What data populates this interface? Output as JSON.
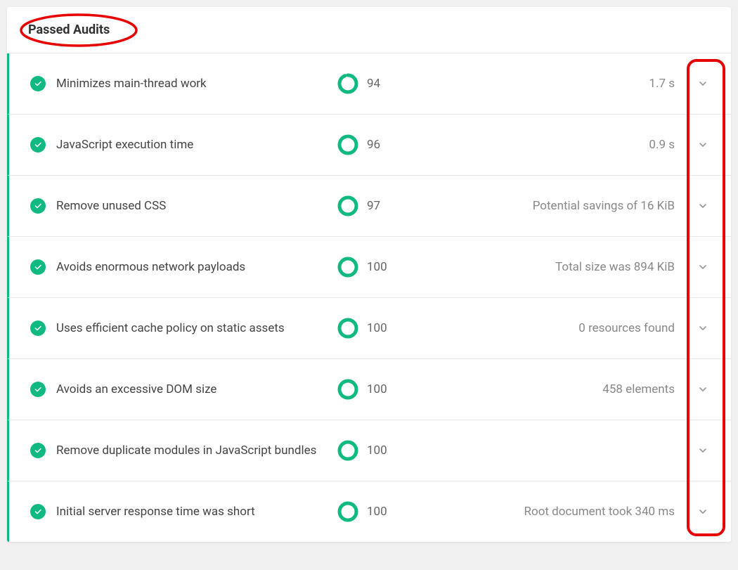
{
  "header": {
    "title": "Passed Audits"
  },
  "colors": {
    "accent": "#10b981",
    "annotation": "#e60000"
  },
  "audits": [
    {
      "title": "Minimizes main-thread work",
      "score": 94,
      "detail": "1.7 s"
    },
    {
      "title": "JavaScript execution time",
      "score": 96,
      "detail": "0.9 s"
    },
    {
      "title": "Remove unused CSS",
      "score": 97,
      "detail": "Potential savings of 16 KiB"
    },
    {
      "title": "Avoids enormous network payloads",
      "score": 100,
      "detail": "Total size was 894 KiB"
    },
    {
      "title": "Uses efficient cache policy on static assets",
      "score": 100,
      "detail": "0 resources found"
    },
    {
      "title": "Avoids an excessive DOM size",
      "score": 100,
      "detail": "458 elements"
    },
    {
      "title": "Remove duplicate modules in JavaScript bundles",
      "score": 100,
      "detail": ""
    },
    {
      "title": "Initial server response time was short",
      "score": 100,
      "detail": "Root document took 340 ms"
    }
  ]
}
